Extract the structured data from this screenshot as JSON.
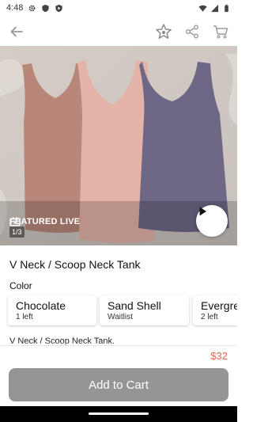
{
  "status_bar": {
    "time": "4:48",
    "icons": [
      "gear-icon",
      "shield-icon",
      "play-protect-icon",
      "wifi-icon",
      "signal-icon",
      "battery-icon"
    ]
  },
  "app_bar": {
    "icons": [
      "back-arrow-icon",
      "star-icon",
      "share-icon",
      "cart-icon"
    ]
  },
  "hero": {
    "badge": "FEATURED LIVE",
    "counter": "1/3",
    "colors": {
      "left_tank": "#b98779",
      "middle_tank": "#e3b3a8",
      "right_tank": "#6e6786",
      "background": "#d8d2cc"
    }
  },
  "product": {
    "title": "V Neck / Scoop Neck Tank",
    "color_label": "Color",
    "variants": [
      {
        "name": "Chocolate",
        "stock": "1 left"
      },
      {
        "name": "Sand Shell",
        "stock": "Waitlist"
      },
      {
        "name": "Evergre",
        "stock": "2 left"
      }
    ],
    "description": "V Neck / Scoop Neck Tank.",
    "price": "$32"
  },
  "actions": {
    "add_to_cart": "Add to Cart"
  },
  "theme": {
    "price_color": "#e8664e",
    "button_color": "#959595"
  }
}
